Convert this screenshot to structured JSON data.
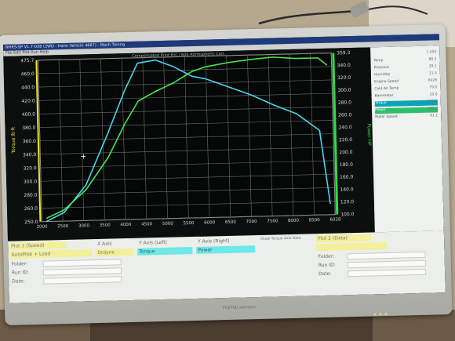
{
  "window": {
    "title": "NHRS-SP V1.7-038 (2WD - Hahn Vehicle 4667) - Mach Tuning",
    "menu": "File   Edit   Plot   Run   Help"
  },
  "chart_header": "Compensated Print   Hrc / 600   Atmospheric Corr.",
  "chart_data": {
    "type": "line",
    "ylabel_left": "Torque lb·ft",
    "ylabel_right": "Power HP",
    "left_ticks": [
      "475.7",
      "460.0",
      "440.0",
      "420.0",
      "400.0",
      "380.0",
      "360.0",
      "340.0",
      "320.0",
      "300.0",
      "280.0",
      "260.0",
      "250.0"
    ],
    "right_ticks": [
      "359.3",
      "340.0",
      "320.0",
      "300.0",
      "280.0",
      "260.0",
      "240.0",
      "220.0",
      "200.0",
      "180.0",
      "160.0",
      "140.0",
      "120.0",
      "100.0"
    ],
    "x_ticks": [
      "2000",
      "2500",
      "3000",
      "3500",
      "4000",
      "4500",
      "5000",
      "5500",
      "6000",
      "6500",
      "7000",
      "7500",
      "8000",
      "8500",
      "6028"
    ],
    "ylim_left": [
      250,
      475.7
    ],
    "ylim_right": [
      100,
      359.3
    ],
    "xlim": [
      2000,
      8500
    ],
    "series": [
      {
        "name": "Torque",
        "color": "#44d6ee",
        "axis": "left",
        "x": [
          2100,
          2500,
          3000,
          3500,
          3900,
          4200,
          4600,
          5000,
          5400,
          5700,
          6200,
          6700,
          7200,
          7700,
          8200,
          8400
        ],
        "y": [
          250,
          262,
          300,
          370,
          430,
          468,
          472,
          462,
          448,
          444,
          432,
          420,
          405,
          392,
          368,
          265
        ]
      },
      {
        "name": "Power",
        "color": "#4be44b",
        "axis": "right",
        "x": [
          2100,
          2500,
          3000,
          3500,
          3900,
          4200,
          4600,
          5000,
          5400,
          5700,
          6200,
          6700,
          7200,
          7700,
          8200,
          8400
        ],
        "y": [
          105,
          118,
          150,
          200,
          255,
          290,
          305,
          318,
          335,
          342,
          348,
          352,
          355,
          352,
          352,
          340
        ]
      }
    ],
    "grid": true,
    "legend": "none"
  },
  "side_values": [
    {
      "label": "",
      "value": "1.209"
    },
    {
      "label": "Temp",
      "value": "88.2"
    },
    {
      "label": "Pressure",
      "value": "29.1"
    },
    {
      "label": "Humidity",
      "value": "31.4"
    },
    {
      "label": "Engine Speed",
      "value": "6028"
    },
    {
      "label": "Cold Air Temp",
      "value": "79.0"
    },
    {
      "label": "Barometer",
      "value": "29.0"
    },
    {
      "label": "Torque",
      "value": "252.3"
    },
    {
      "label": "Power",
      "value": "290.2"
    },
    {
      "label": "Roller Speed",
      "value": "91.1"
    }
  ],
  "controls": {
    "plot_label": "Plot 1 (Speed)",
    "x_axis_label": "X Axis",
    "y_left_label": "Y Axis (Left)",
    "y_right_label": "Y Axis (Right)",
    "show_label": "Show Torque Axis Data",
    "plot2_label": "Plot 2 (Data)",
    "x_axis_value": "AutoPilot + Load",
    "x_unit_value": "Drdyne",
    "y_left_value": "Torque",
    "y_right_value": "Power",
    "folder_label": "Folder:",
    "run_label": "Run ID:",
    "date_label": "Date:"
  },
  "brand": "FUJITSU siemens"
}
